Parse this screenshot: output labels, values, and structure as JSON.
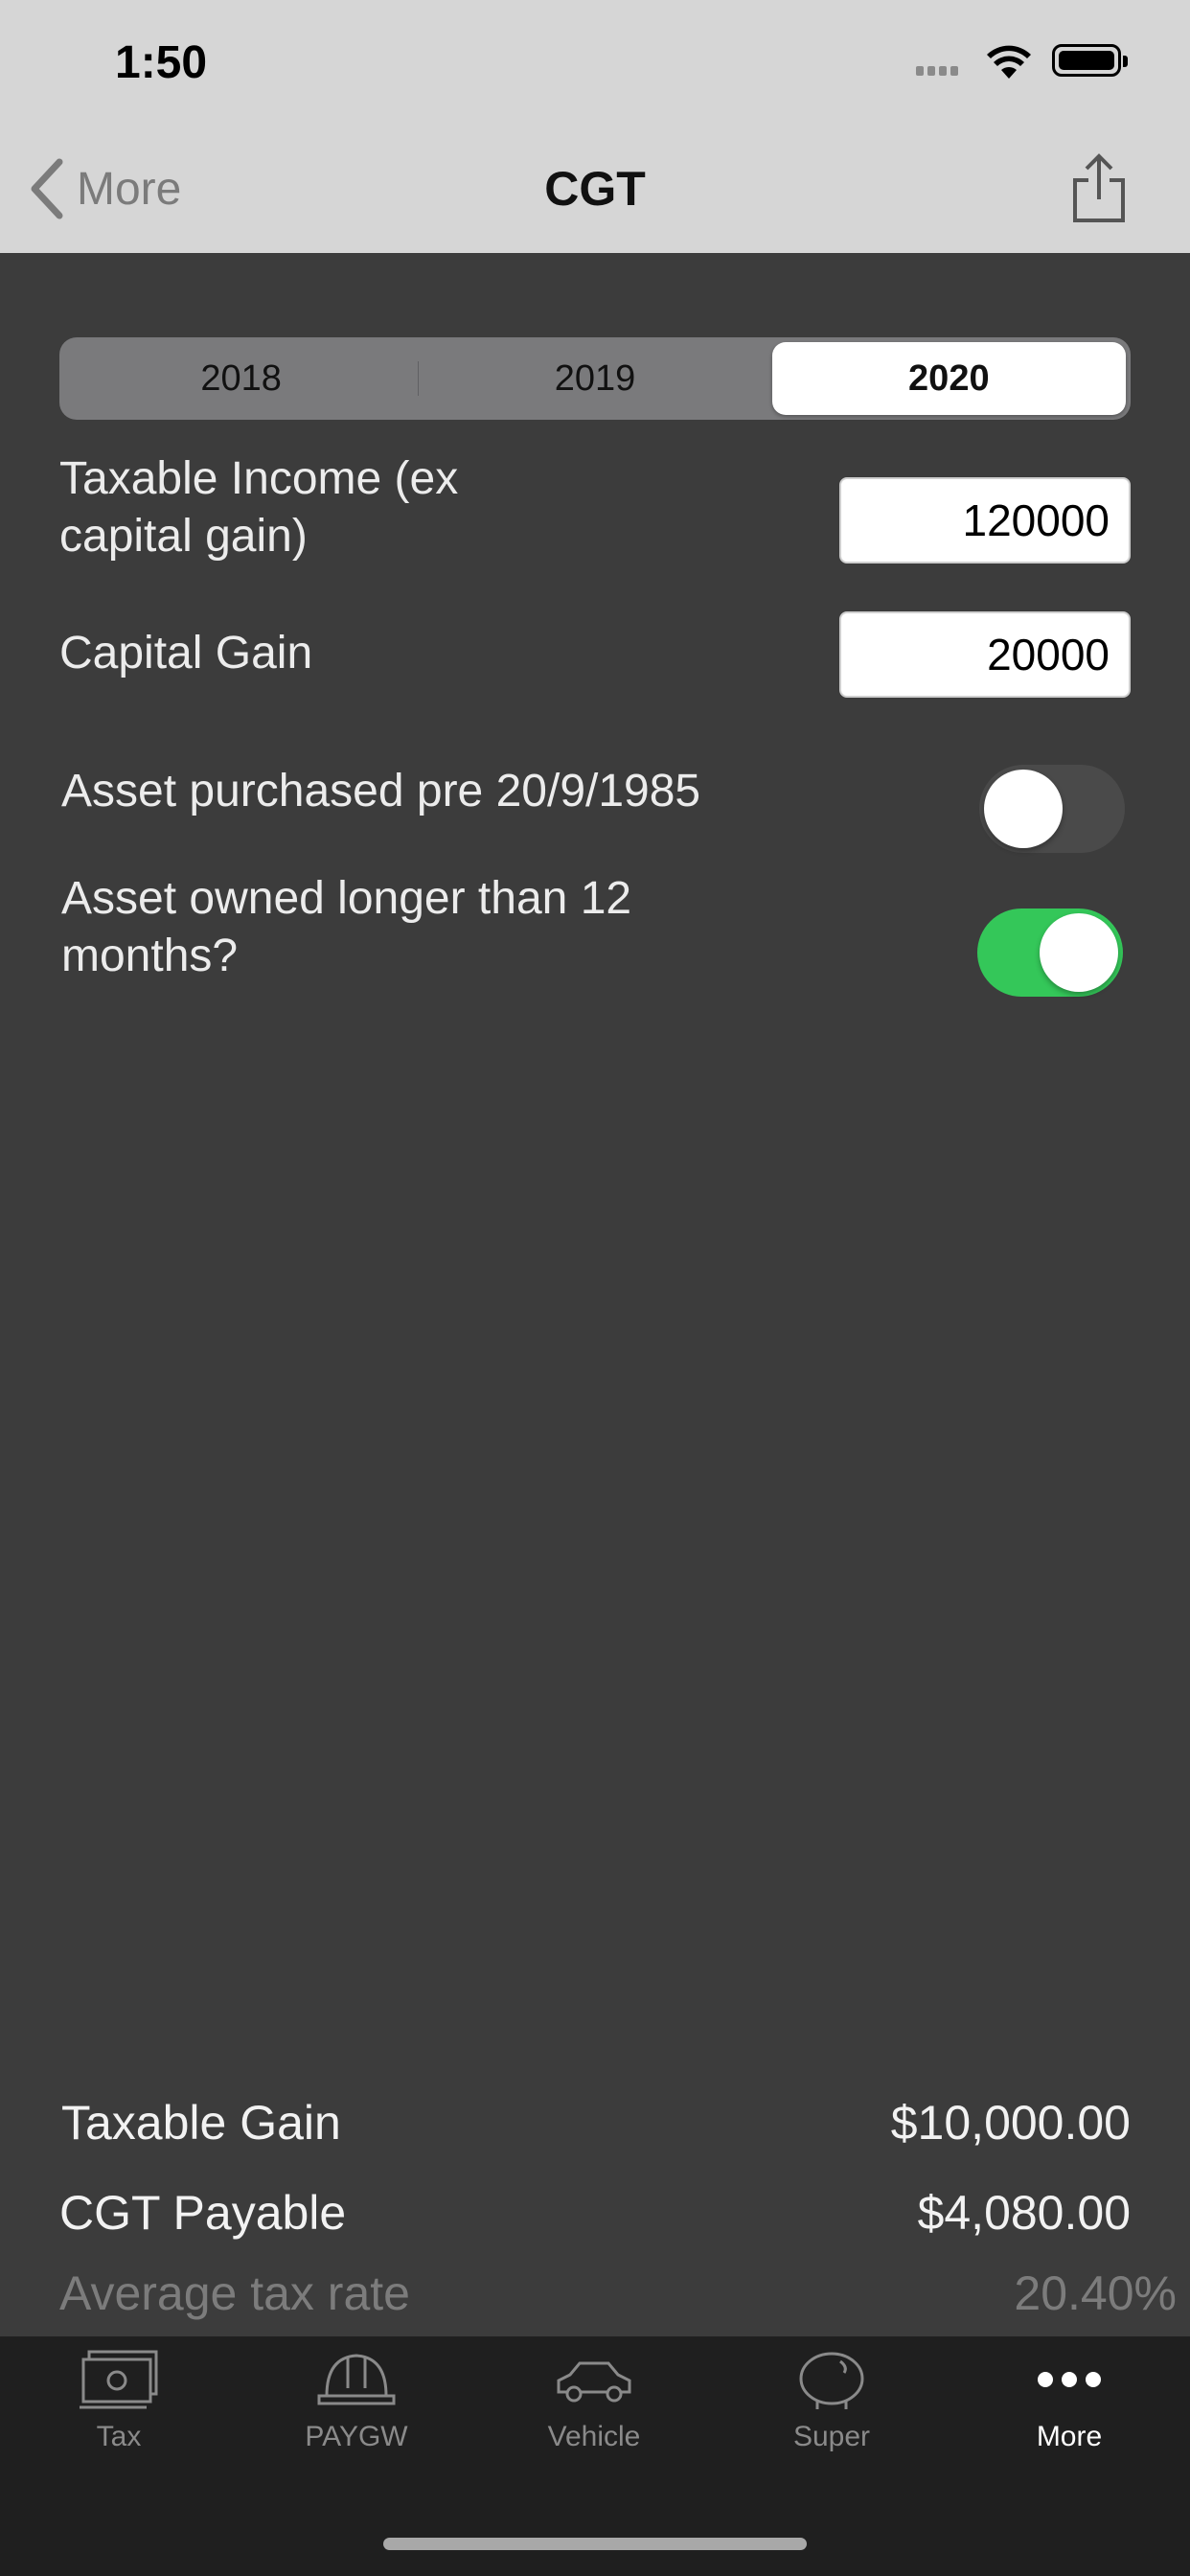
{
  "status_bar": {
    "time": "1:50"
  },
  "nav": {
    "back_label": "More",
    "title": "CGT"
  },
  "years": {
    "options": [
      "2018",
      "2019",
      "2020"
    ],
    "selected": "2020"
  },
  "form": {
    "taxable_income": {
      "label": "Taxable Income (ex capital gain)",
      "value": "120000"
    },
    "capital_gain": {
      "label": "Capital Gain",
      "value": "20000"
    },
    "pre_1985": {
      "label": "Asset purchased pre 20/9/1985",
      "on": false
    },
    "owned_12_months": {
      "label": "Asset owned longer than 12 months?",
      "on": true
    }
  },
  "results": {
    "taxable_gain": {
      "label": "Taxable Gain",
      "value": "$10,000.00"
    },
    "cgt_payable": {
      "label": "CGT Payable",
      "value": "$4,080.00"
    },
    "average_rate": {
      "label": "Average tax rate",
      "value": "20.40%"
    }
  },
  "tabs": [
    {
      "label": "Tax",
      "icon": "cash-icon"
    },
    {
      "label": "PAYGW",
      "icon": "hard-hat-icon"
    },
    {
      "label": "Vehicle",
      "icon": "car-icon"
    },
    {
      "label": "Super",
      "icon": "piggy-bank-icon"
    },
    {
      "label": "More",
      "icon": "more-icon",
      "active": true
    }
  ],
  "colors": {
    "toggle_on": "#34c759",
    "nav_bg": "#d6d6d6",
    "content_bg": "#3c3c3c",
    "tab_bar_bg": "#1f1f1f"
  }
}
